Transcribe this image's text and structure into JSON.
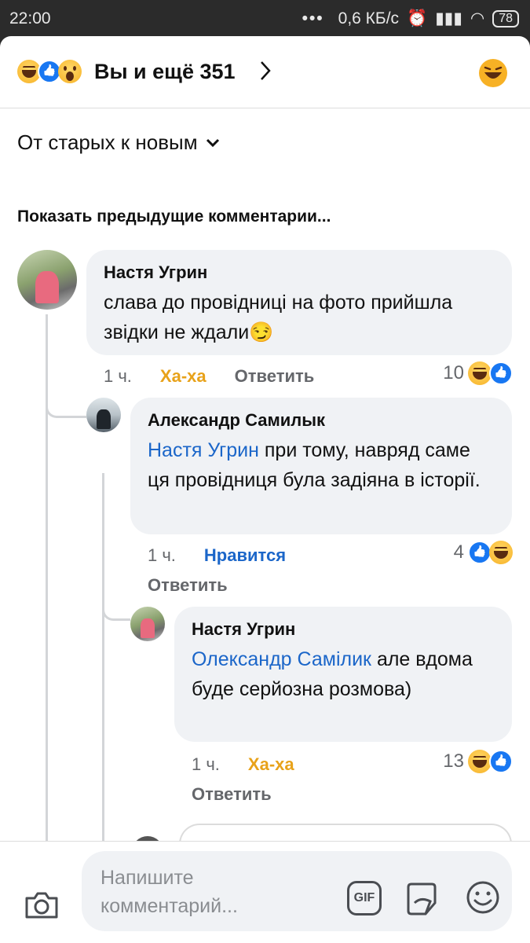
{
  "status": {
    "time": "22:00",
    "network_speed": "0,6 КБ/с",
    "battery": "78"
  },
  "header": {
    "title": "Вы и ещё 351"
  },
  "sort": {
    "label": "От старых к новым"
  },
  "show_previous": "Показать предыдущие комментарии...",
  "comments": [
    {
      "author": "Настя Угрин",
      "text": "слава до провідниці на фото прийшла звідки не ждали😏",
      "time": "1 ч.",
      "reaction_label": "Ха-ха",
      "reply_label": "Ответить",
      "reaction_count": "10"
    },
    {
      "author": "Александр Самилык",
      "mention": "Настя Угрин",
      "text": " при тому, навряд саме ця провідниця була задіяна в історії.",
      "time": "1 ч.",
      "reaction_label": "Нравится",
      "reply_label": "Ответить",
      "reaction_count": "4"
    },
    {
      "author": "Настя Угрин",
      "mention": "Олександр Самілик",
      "text": " але вдома буде серйозна розмова)",
      "time": "1 ч.",
      "reaction_label": "Ха-ха",
      "reply_label": "Ответить",
      "reaction_count": "13"
    }
  ],
  "composer": {
    "placeholder": "Напишите комментарий...",
    "gif_label": "GIF"
  },
  "colors": {
    "accent": "#1b66c9",
    "haha": "#e8a21a",
    "bubble": "#f0f2f5"
  }
}
